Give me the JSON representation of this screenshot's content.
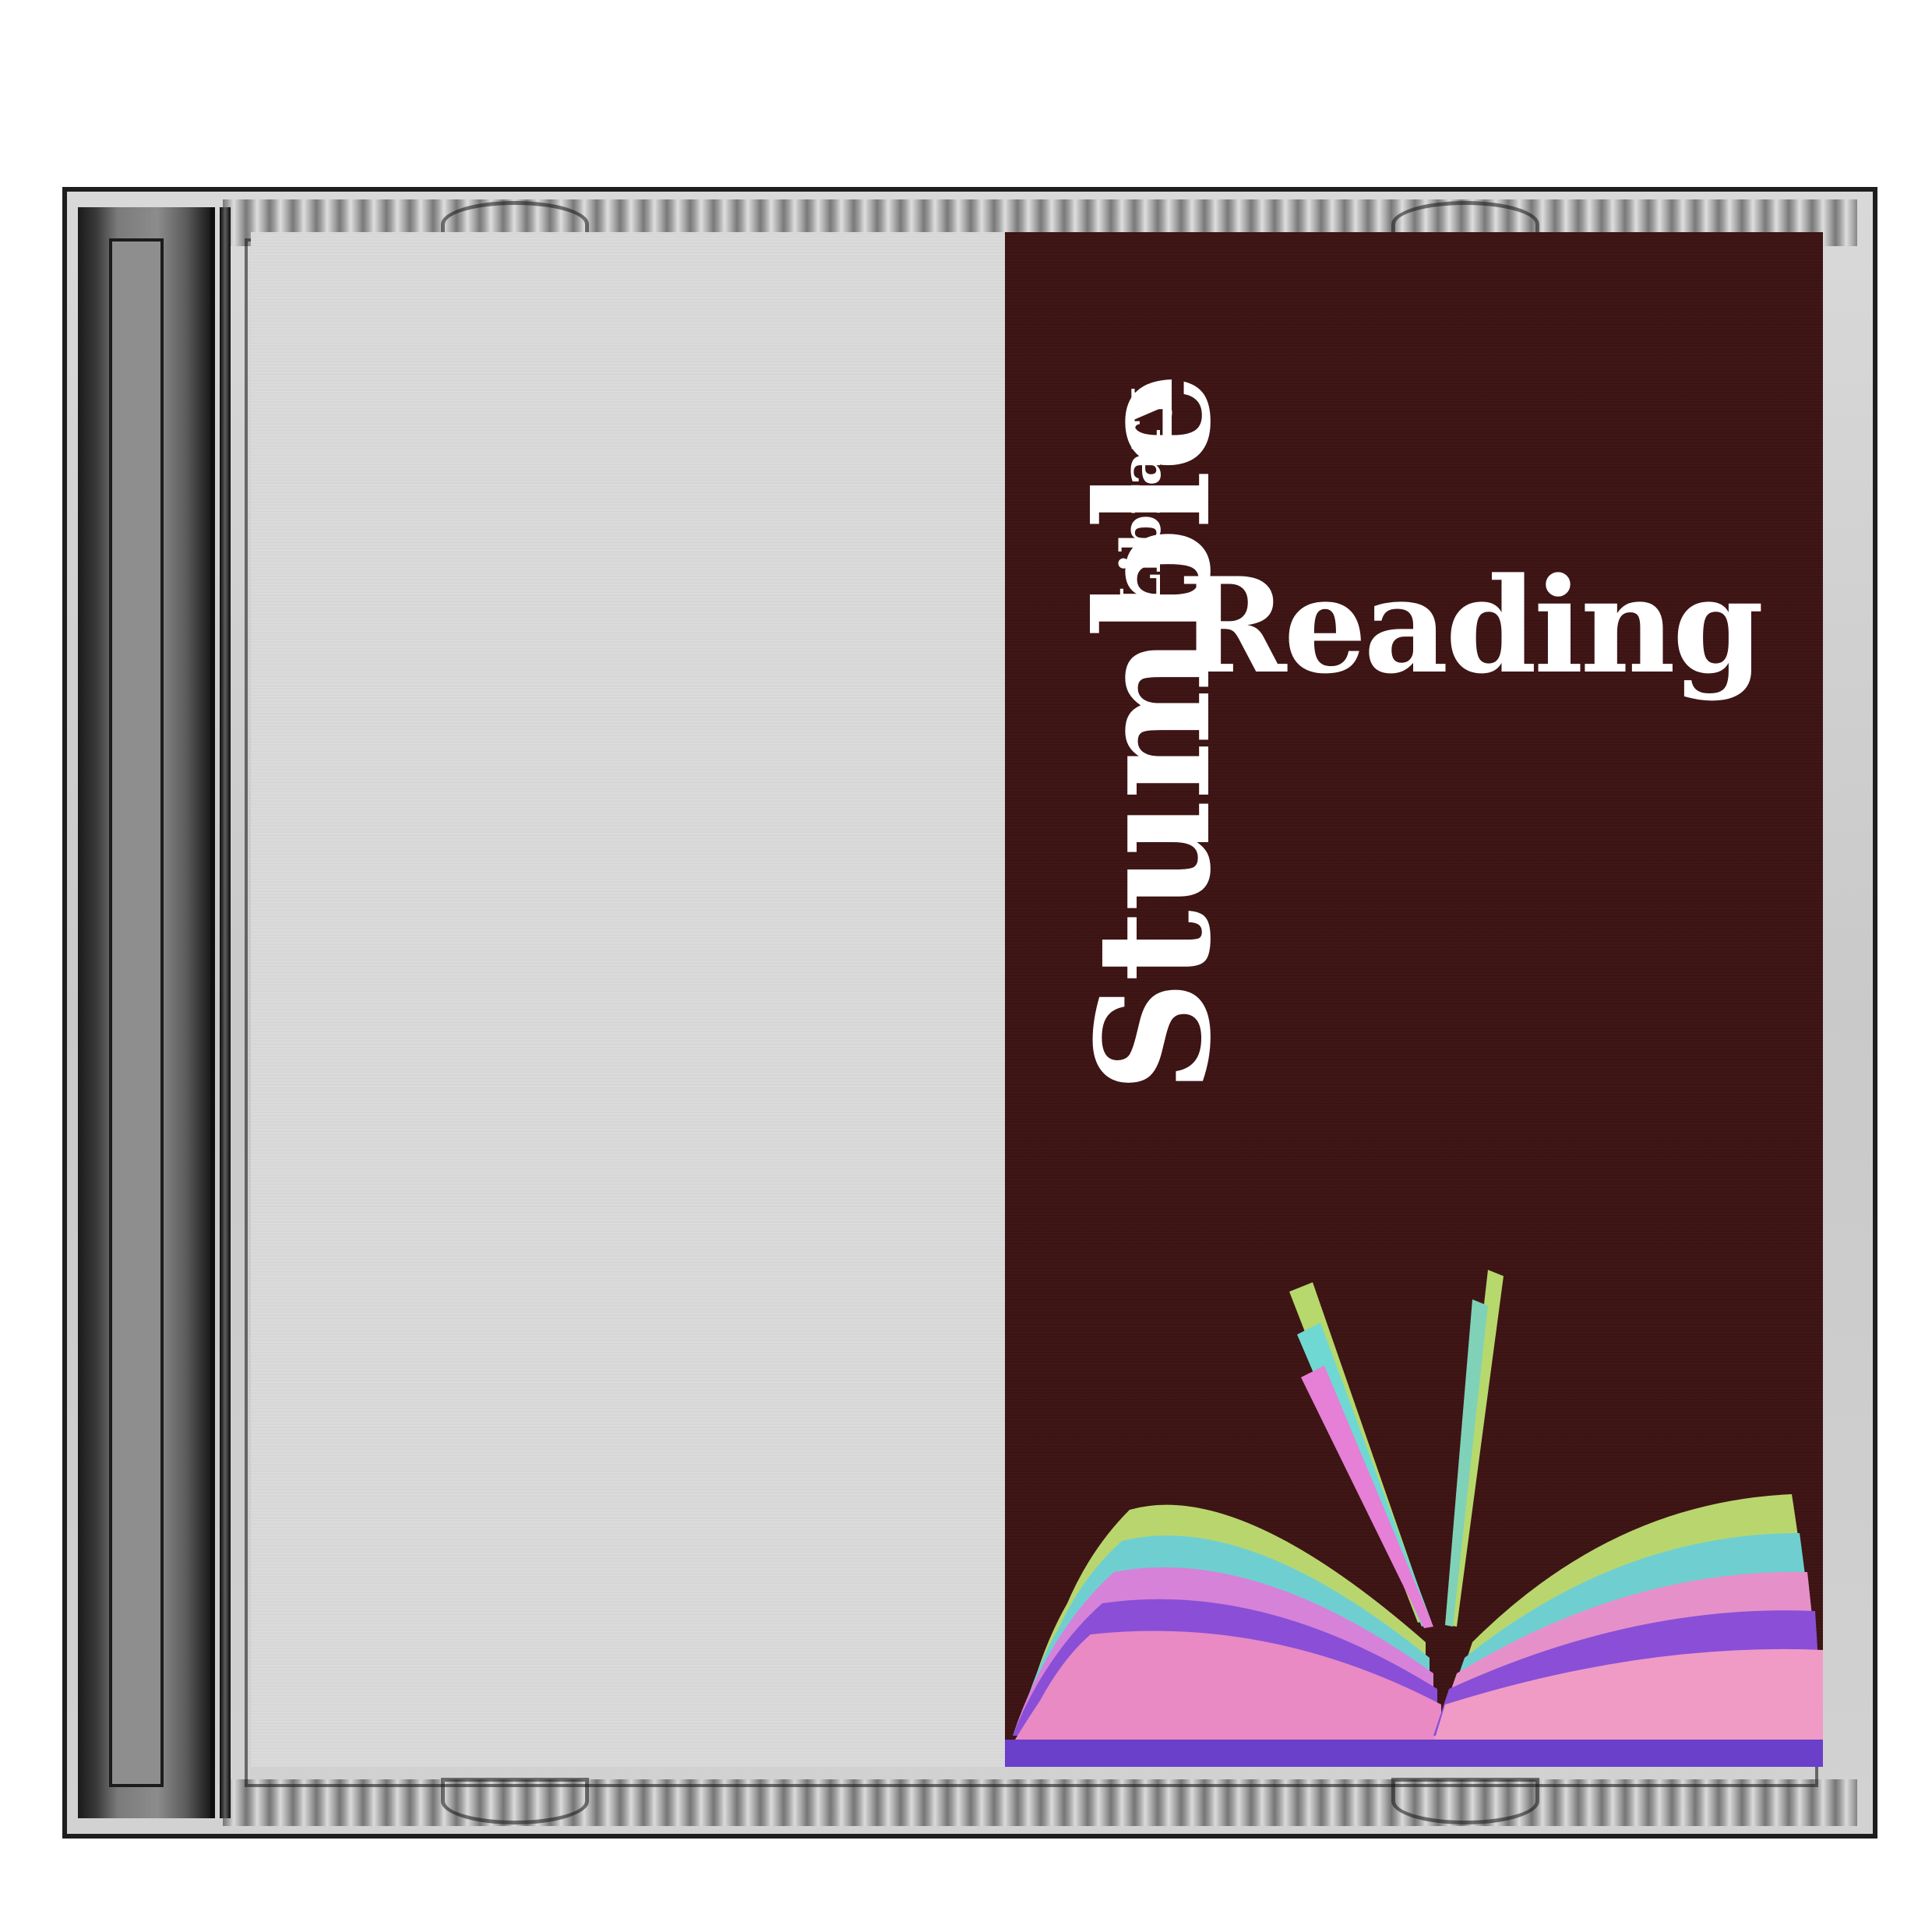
{
  "cover": {
    "brand": "Stumble",
    "subtitle": "Library",
    "title": "Reading",
    "background_color": "#3b1414",
    "text_color": "#ffffff"
  },
  "book_icon": "open-book-illustration",
  "case": {
    "type": "cd-jewel-case",
    "left_panel_color": "#d6d6d6"
  }
}
